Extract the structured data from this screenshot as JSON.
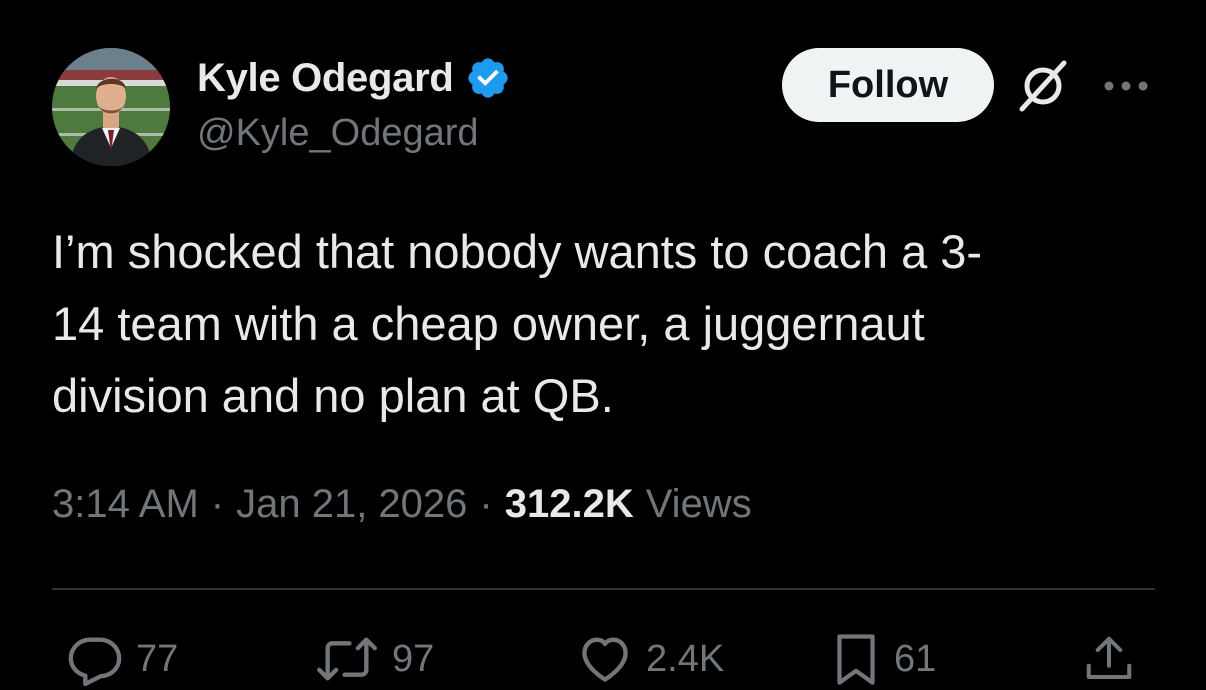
{
  "author": {
    "display_name": "Kyle Odegard",
    "handle": "@Kyle_Odegard",
    "verified": true
  },
  "header": {
    "follow_label": "Follow",
    "grok_icon": "grok-icon",
    "more_icon": "more-icon"
  },
  "tweet": {
    "text": "I’m shocked that nobody wants to coach a 3-\n14 team with a cheap owner, a juggernaut\ndivision and no plan at QB."
  },
  "meta": {
    "time": "3:14 AM",
    "separator": "·",
    "date": "Jan 21, 2026",
    "views_count": "312.2K",
    "views_label": "Views"
  },
  "actions": {
    "replies": "77",
    "reposts": "97",
    "likes": "2.4K",
    "bookmarks": "61"
  },
  "colors": {
    "background": "#000000",
    "text_primary": "#e7e9ea",
    "text_secondary": "#71767b",
    "verified_blue": "#1d9bf0",
    "follow_bg": "#eff3f4",
    "divider": "#2f3336"
  }
}
